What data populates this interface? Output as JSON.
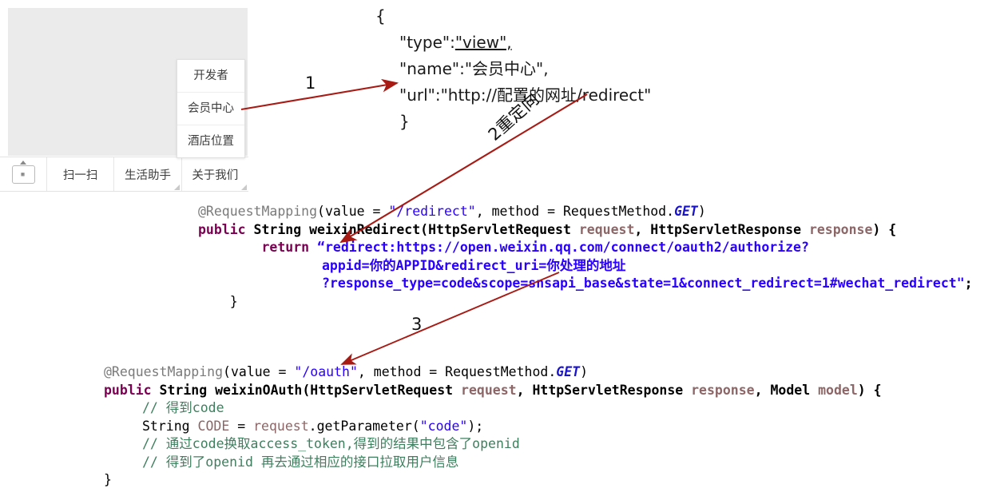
{
  "phone": {
    "screen_placeholder": "",
    "popup_menu": {
      "name": "wechat-custom-menu-popup",
      "items": [
        {
          "label": "开发者"
        },
        {
          "label": "会员中心"
        },
        {
          "label": "酒店位置"
        }
      ]
    },
    "nav_bar": {
      "keyboard_icon": "keyboard-icon",
      "items": [
        {
          "label": "扫一扫",
          "has_submenu": false
        },
        {
          "label": "生活助手",
          "has_submenu": true
        },
        {
          "label": "关于我们",
          "has_submenu": true
        }
      ]
    }
  },
  "json_block": {
    "line_open": "{",
    "line_type": "\"type\":",
    "line_type_value": "\"view\",",
    "line_name": "\"name\":\"会员中心\",",
    "line_url": "\"url\":\"http://配置的网址/redirect\"",
    "line_close": "}"
  },
  "annotations": {
    "step1_label": "1",
    "step2_label": "2重定向",
    "step3_label": "3",
    "arrow_color": "#a81a14"
  },
  "code_redirect": {
    "l1_annotation": "@RequestMapping",
    "l1_a": "(value = ",
    "l1_path": "\"/redirect\"",
    "l1_b": ", method = RequestMethod.",
    "l1_get": "GET",
    "l1_c": ")",
    "l2_kw": "public",
    "l2_a": " String weixinRedirect(HttpServletRequest ",
    "l2_p1": "request",
    "l2_b": ", HttpServletResponse ",
    "l2_p2": "response",
    "l2_c": ") {",
    "l3_indent": "        ",
    "l3_kw": "return",
    "l3_str": " “redirect:https://open.weixin.qq.com/connect/oauth2/authorize?",
    "l4_str": "appid=你的APPID&redirect_uri=你处理的地址",
    "l5_str": "?response_type=code&scope=snsapi_base&state=1&connect_redirect=1#wechat_redirect\"",
    "l5_end": ";",
    "l6_close": "    }"
  },
  "code_oauth": {
    "l1_annotation": "@RequestMapping",
    "l1_a": "(value = ",
    "l1_path": "\"/oauth\"",
    "l1_b": ", method = RequestMethod.",
    "l1_get": "GET",
    "l1_c": ")",
    "l2_kw": "public",
    "l2_a": " String weixinOAuth(HttpServletRequest ",
    "l2_p1": "request",
    "l2_b": ", HttpServletResponse ",
    "l2_p2": "response",
    "l2_c": ", Model ",
    "l2_p3": "model",
    "l2_d": ") {",
    "l3_comment": "// 得到code",
    "l4_a": "String ",
    "l4_var": "CODE",
    "l4_b": " = ",
    "l4_obj": "request",
    "l4_c": ".getParameter(",
    "l4_str": "\"code\"",
    "l4_d": ");",
    "l5_comment": "// 通过code换取access_token,得到的结果中包含了openid",
    "l6_comment": "// 得到了openid 再去通过相应的接口拉取用户信息",
    "l7_close": "}"
  }
}
